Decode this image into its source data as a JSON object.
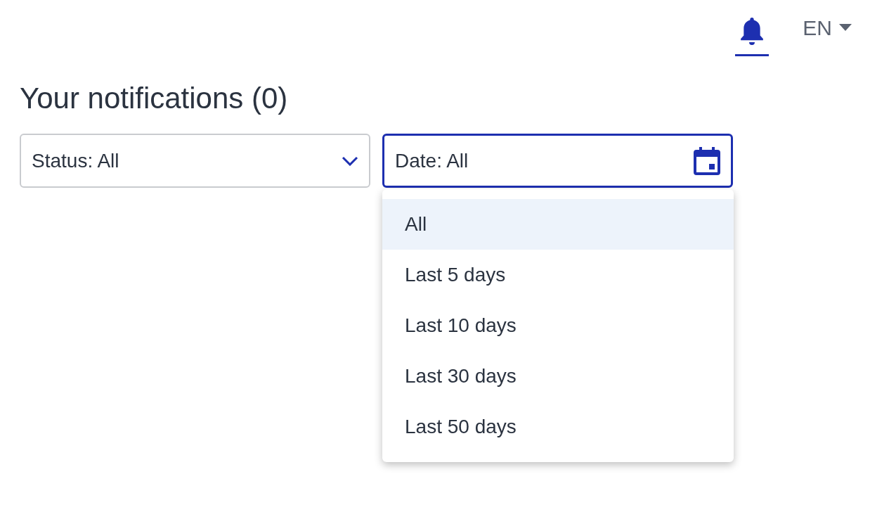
{
  "header": {
    "notifications_tab": {
      "selected": true
    },
    "language": "EN"
  },
  "title": "Your notifications (0)",
  "filters": {
    "status": {
      "value": "Status: All"
    },
    "date": {
      "value": "Date: All",
      "open": true,
      "options": [
        {
          "label": "All",
          "selected": true
        },
        {
          "label": "Last 5 days",
          "selected": false
        },
        {
          "label": "Last 10 days",
          "selected": false
        },
        {
          "label": "Last 30 days",
          "selected": false
        },
        {
          "label": "Last 50 days",
          "selected": false
        }
      ]
    }
  }
}
